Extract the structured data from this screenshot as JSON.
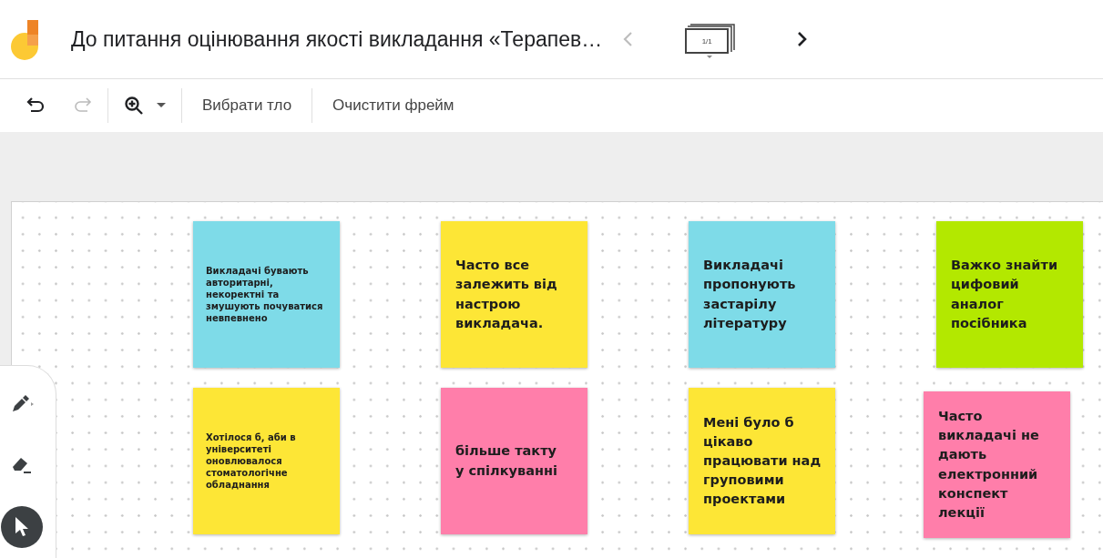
{
  "header": {
    "title": "До питання оцінювання якості викладання «Терапев…",
    "prev_disabled": true,
    "next_disabled": false,
    "frame_counter": "1/1"
  },
  "toolbar": {
    "undo_disabled": false,
    "redo_disabled": true,
    "buttons": [
      "Вибрати тло",
      "Очистити фрейм"
    ]
  },
  "tools": [
    {
      "kind": "pen",
      "selected": false
    },
    {
      "kind": "eraser",
      "selected": false
    },
    {
      "kind": "pointer",
      "selected": true
    }
  ],
  "notes": [
    {
      "text": "Викладачі бувають авторитарні, некоректні та змушують почуватися невпевнено",
      "color": "#7edbe8",
      "kind": "small"
    },
    {
      "text": "Часто все залежить від настрою викладача.",
      "color": "#fde636",
      "kind": "large"
    },
    {
      "text": "Викладачі пропонують застарілу літературу",
      "color": "#7edbe8",
      "kind": "large"
    },
    {
      "text": "Важко знайти цифовий аналог посібника",
      "color": "#b3e800",
      "kind": "large"
    },
    {
      "text": "Хотілося б, аби в університеті оновлювалося стоматологічне обладнання",
      "color": "#fde636",
      "kind": "small"
    },
    {
      "text": "більше такту у спілкуванні",
      "color": "#ff7eaa",
      "kind": "large"
    },
    {
      "text": "Мені було б цікаво працювати над груповими проектами",
      "color": "#fde636",
      "kind": "large"
    },
    {
      "text": "Часто викладачі не дають електронний конспект лекції",
      "color": "#ff7eaa",
      "kind": "large"
    }
  ]
}
